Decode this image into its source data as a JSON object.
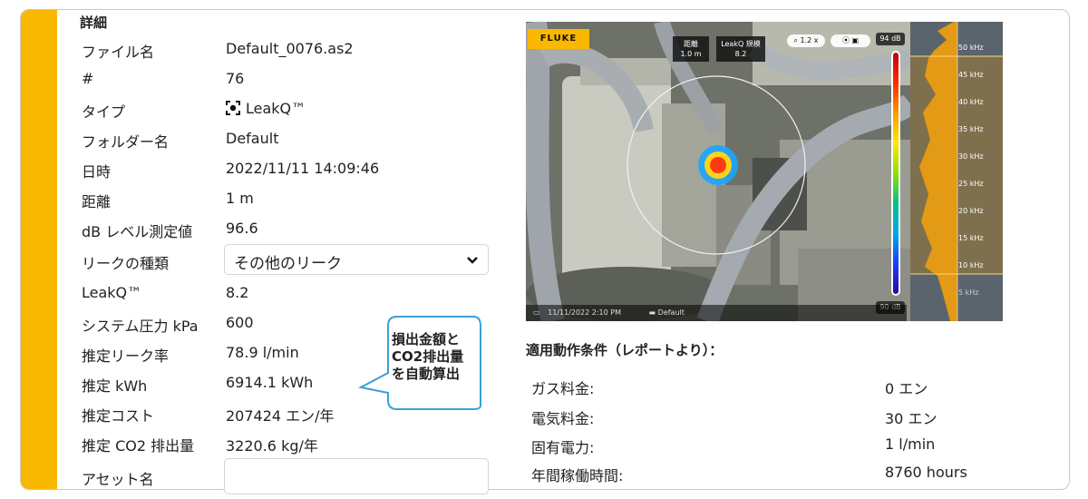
{
  "section_title": "詳細",
  "details": [
    {
      "label": "ファイル名",
      "value": "Default_0076.as2"
    },
    {
      "label": "#",
      "value": "76"
    },
    {
      "label": "タイプ",
      "value": "LeakQ™",
      "icon": "leakq-target-icon"
    },
    {
      "label": "フォルダー名",
      "value": "Default"
    },
    {
      "label": "日時",
      "value": "2022/11/11 14:09:46"
    },
    {
      "label": "距離",
      "value": "1 m"
    },
    {
      "label": "dB レベル測定値",
      "value": "96.6"
    },
    {
      "label": "リークの種類",
      "value": "その他のリーク",
      "control": "select"
    },
    {
      "label": "LeakQ™",
      "value": "8.2"
    },
    {
      "label": "システム圧力 kPa",
      "value": "600"
    },
    {
      "label": "推定リーク率",
      "value": "78.9 l/min"
    },
    {
      "label": "推定 kWh",
      "value": "6914.1 kWh"
    },
    {
      "label": "推定コスト",
      "value": "207424 エン/年"
    },
    {
      "label": "推定 CO2 排出量",
      "value": "3220.6 kg/年"
    },
    {
      "label": "アセット名",
      "value": "",
      "control": "input"
    }
  ],
  "callout": {
    "line1": "損出金額と",
    "line2": "CO2排出量",
    "line3": "を自動算出"
  },
  "image": {
    "brand": "FLUKE",
    "distance_label": "距離",
    "distance_value": "1.0 m",
    "leakq_label": "LeakQ 規模",
    "leakq_value": "8.2",
    "zoom": "1.2 x",
    "db_max": "94 dB",
    "db_min": "90 dB",
    "timestamp": "11/11/2022   2:10 PM",
    "folder": "Default",
    "frequencies": [
      "50 kHz",
      "45 kHz",
      "40 kHz",
      "35 kHz",
      "30 kHz",
      "25 kHz",
      "20 kHz",
      "15 kHz",
      "10 kHz",
      "5 kHz"
    ]
  },
  "conditions": {
    "title": "適用動作条件（レポートより）：",
    "rows": [
      {
        "label": "ガス料金:",
        "value": "0 エン"
      },
      {
        "label": "電気料金:",
        "value": "30 エン"
      },
      {
        "label": "固有電力:",
        "value": "1 l/min"
      },
      {
        "label": "年間稼働時間:",
        "value": "8760 hours"
      }
    ]
  },
  "colors": {
    "accent": "#fbb800",
    "callout_border": "#3aa0d8"
  }
}
